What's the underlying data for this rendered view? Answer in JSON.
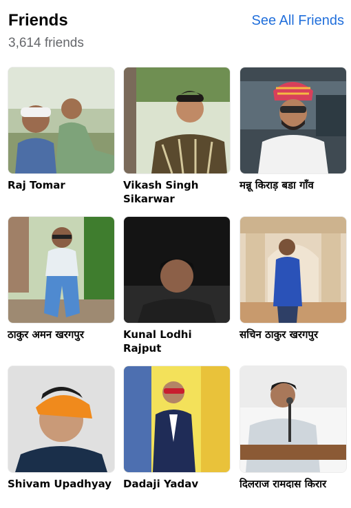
{
  "header": {
    "title": "Friends",
    "count": "3,614 friends",
    "see_all": "See All Friends"
  },
  "friends": [
    {
      "name": "Raj Tomar"
    },
    {
      "name": "Vikash Singh Sikarwar"
    },
    {
      "name": "मन्नू किराड़ बडा गाँव"
    },
    {
      "name": "ठाकुर अमन खरगपुर"
    },
    {
      "name": "Kunal Lodhi Rajput"
    },
    {
      "name": "सचिन ठाकुर खरगपुर"
    },
    {
      "name": "Shivam Upadhyay"
    },
    {
      "name": "Dadaji Yadav"
    },
    {
      "name": "दिलराज रामदास किरार"
    }
  ]
}
